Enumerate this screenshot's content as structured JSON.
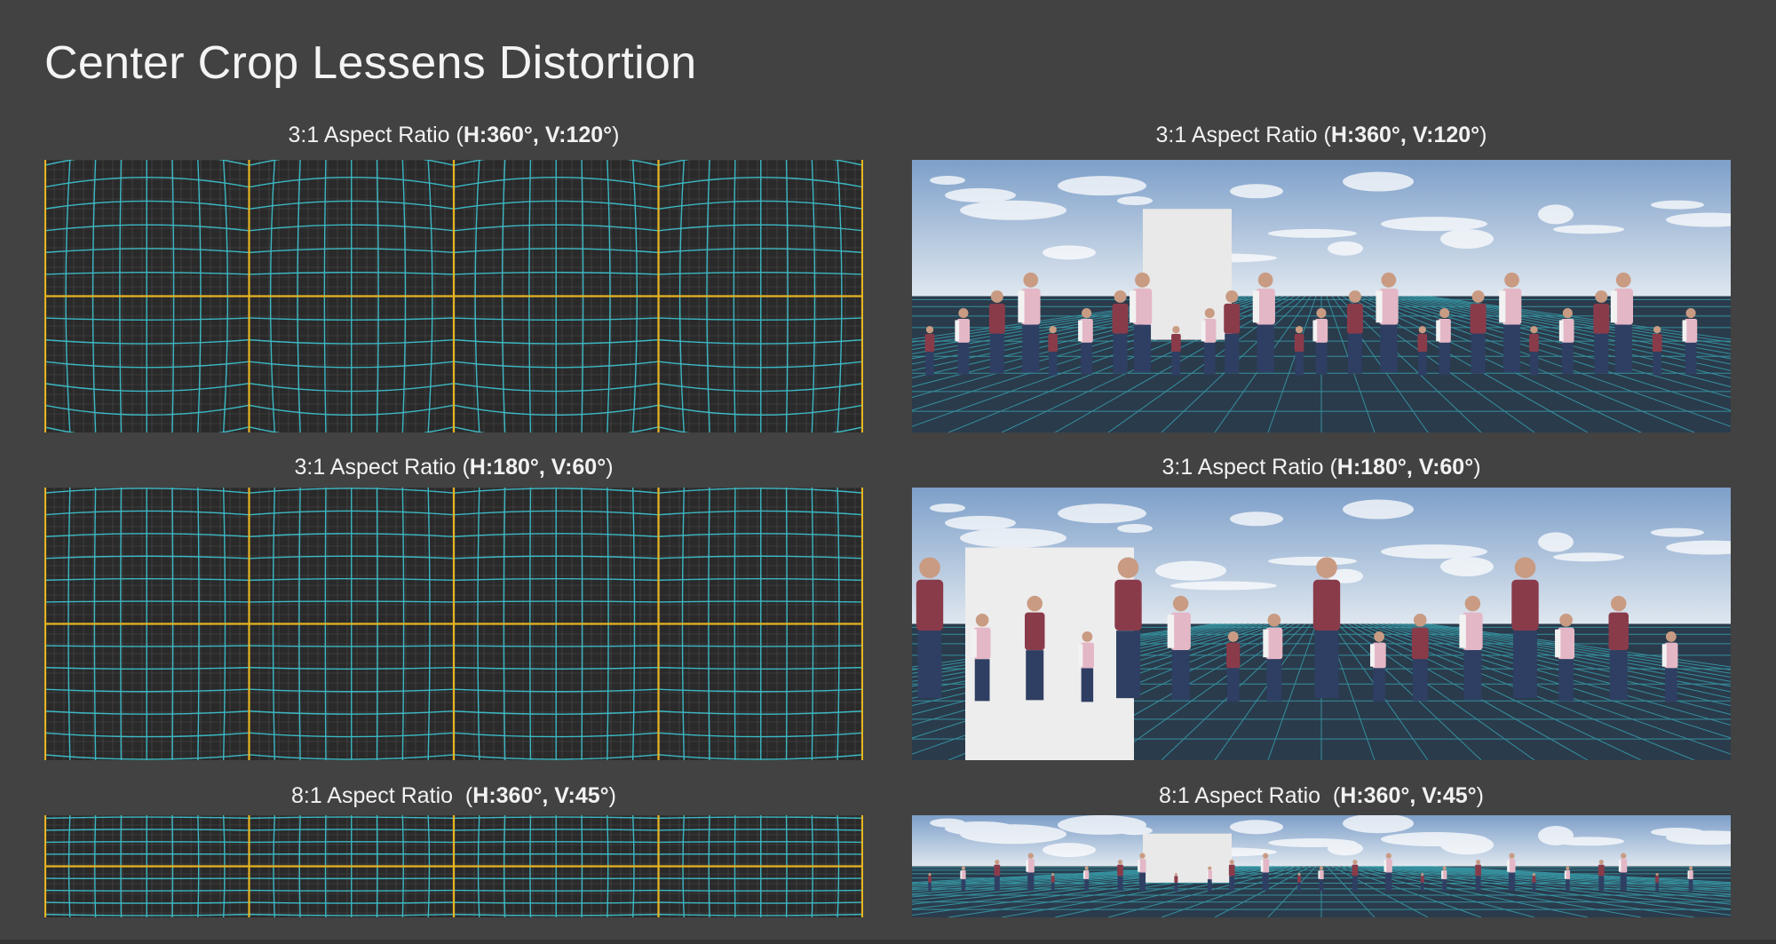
{
  "title": "Center Crop Lessens Distortion",
  "rows": [
    {
      "label_prefix": "3:1 Aspect Ratio (",
      "label_bold": "H:360°, V:120°",
      "label_suffix": ")"
    },
    {
      "label_prefix": "3:1 Aspect Ratio (",
      "label_bold": "H:180°, V:60°",
      "label_suffix": ")"
    },
    {
      "label_prefix": "8:1 Aspect Ratio  (",
      "label_bold": "H:360°, V:45°",
      "label_suffix": ")"
    }
  ],
  "colors": {
    "background": "#424242",
    "grid_cyan": "#3ec8d4",
    "grid_yellow": "#e6b422",
    "grid_fine": "#6a6a6a",
    "sky_top": "#7d9fc9",
    "sky_bottom": "#dfe7ef",
    "floor": "#2a3b4c"
  }
}
